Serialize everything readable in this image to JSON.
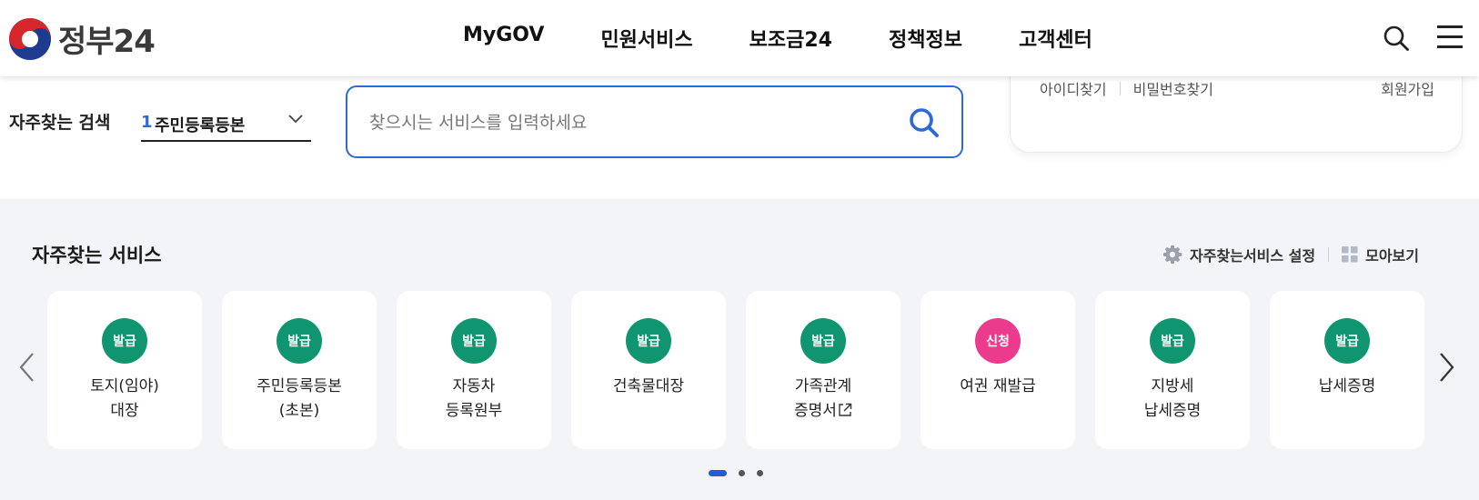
{
  "header": {
    "logo_text": "정부24",
    "nav": [
      "MyGOV",
      "민원서비스",
      "보조금24",
      "정책정보",
      "고객센터"
    ],
    "search_icon": "search-icon",
    "menu_icon": "hamburger-menu-icon"
  },
  "search": {
    "frequent_label": "자주찾는 검색",
    "selected_rank": "1",
    "selected_value": "주민등록등본",
    "placeholder": "찾으시는 서비스를 입력하세요",
    "accent_color": "#2c6bd6"
  },
  "login_panel": {
    "find_id": "아이디찾기",
    "find_password": "비밀번호찾기",
    "join": "회원가입"
  },
  "services": {
    "title": "자주찾는 서비스",
    "settings_label": "자주찾는서비스 설정",
    "view_all_label": "모아보기",
    "colors": {
      "issue": "#0f9570",
      "apply": "#ec3a8c"
    },
    "cards": [
      {
        "badge": "발급",
        "badge_type": "issue",
        "line1": "토지(임야)",
        "line2": "대장"
      },
      {
        "badge": "발급",
        "badge_type": "issue",
        "line1": "주민등록등본",
        "line2": "(초본)"
      },
      {
        "badge": "발급",
        "badge_type": "issue",
        "line1": "자동차",
        "line2": "등록원부"
      },
      {
        "badge": "발급",
        "badge_type": "issue",
        "line1": "건축물대장",
        "line2": ""
      },
      {
        "badge": "발급",
        "badge_type": "issue",
        "line1": "가족관계",
        "line2": "증명서",
        "external": true
      },
      {
        "badge": "신청",
        "badge_type": "apply",
        "line1": "여권 재발급",
        "line2": ""
      },
      {
        "badge": "발급",
        "badge_type": "issue",
        "line1": "지방세",
        "line2": "납세증명"
      },
      {
        "badge": "발급",
        "badge_type": "issue",
        "line1": "납세증명",
        "line2": ""
      }
    ],
    "pagination": {
      "current": 1,
      "total": 3
    }
  }
}
